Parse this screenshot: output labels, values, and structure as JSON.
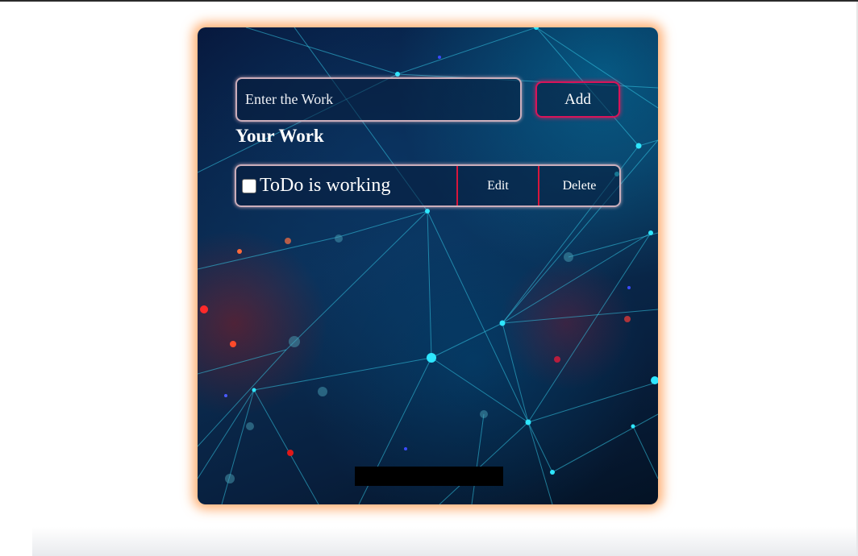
{
  "form": {
    "input_placeholder": "Enter the Work",
    "input_value": "",
    "add_label": "Add"
  },
  "list": {
    "title": "Your Work",
    "items": [
      {
        "text": "ToDo is working",
        "checked": false,
        "edit_label": "Edit",
        "delete_label": "Delete"
      }
    ]
  },
  "icons": {
    "checkbox": "checkbox-icon"
  },
  "colors": {
    "card_glow": "#ff9646",
    "add_border": "#d8145a",
    "item_divider": "#d8163c",
    "text": "#ffffff",
    "network_line": "#35c8e6",
    "network_node": "#2ee6ff"
  }
}
